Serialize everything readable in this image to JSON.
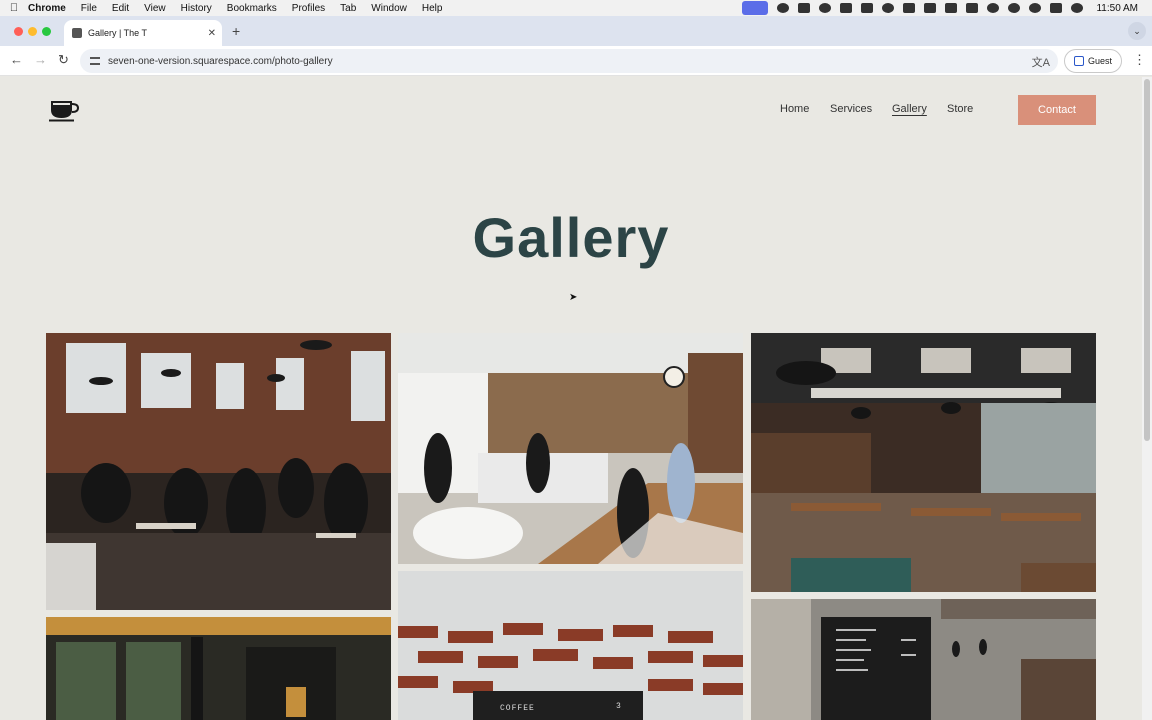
{
  "menubar": {
    "app_name": "Chrome",
    "items": [
      "File",
      "Edit",
      "View",
      "History",
      "Bookmarks",
      "Profiles",
      "Tab",
      "Window",
      "Help"
    ],
    "clock": "11:50 AM"
  },
  "browser": {
    "tab_title": "Gallery | The T",
    "url": "seven-one-version.squarespace.com/photo-gallery",
    "profile_label": "Guest"
  },
  "site": {
    "nav": [
      "Home",
      "Services",
      "Gallery",
      "Store"
    ],
    "active_nav": "Gallery",
    "contact_label": "Contact",
    "page_title": "Gallery",
    "accent_color": "#d9907a",
    "title_color": "#2c4446",
    "background_color": "#e9e8e3"
  },
  "gallery": {
    "menu_board_sign": "COFFEE",
    "menu_board_number": "3"
  }
}
